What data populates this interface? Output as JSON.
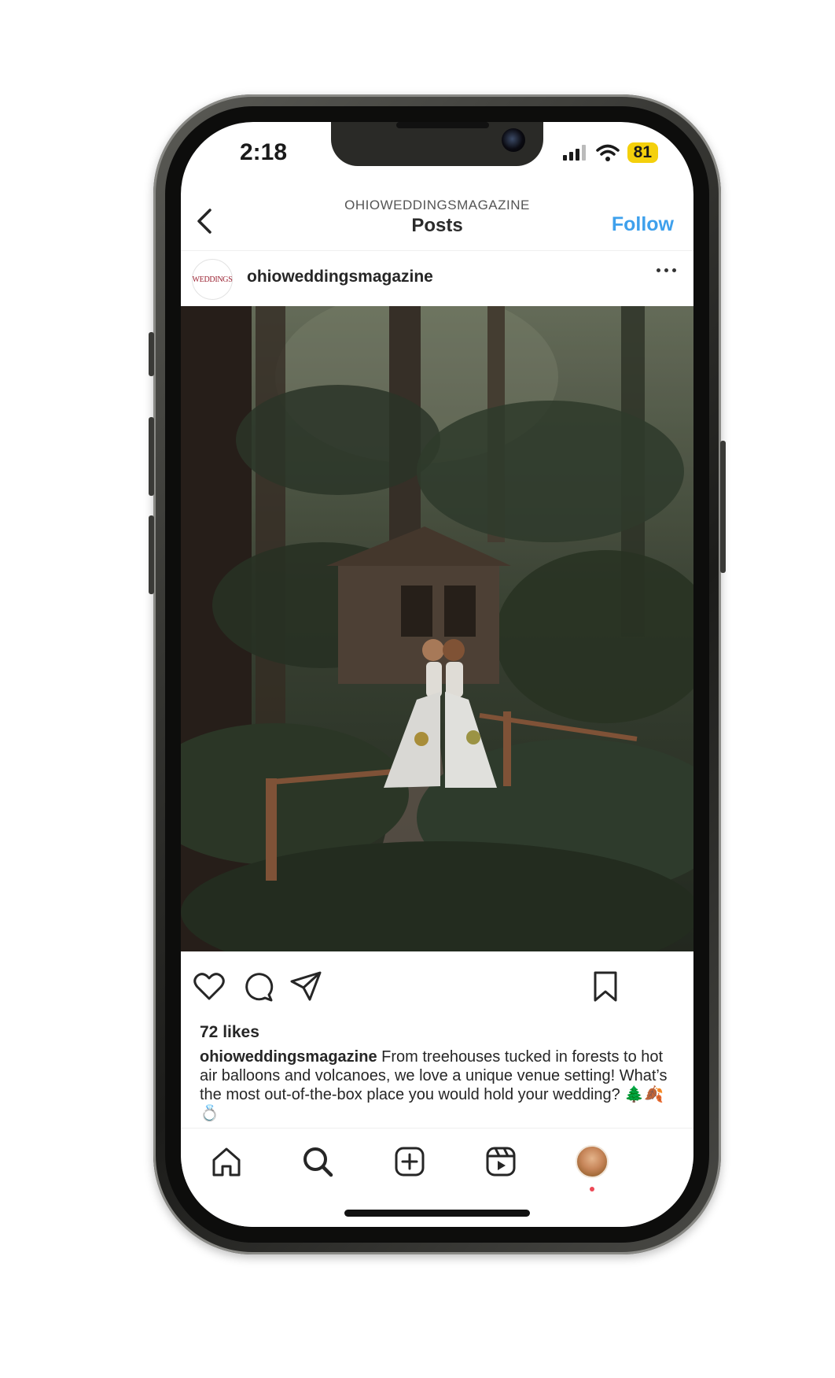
{
  "status_bar": {
    "time": "2:18",
    "battery_level": "81",
    "icons": [
      "signal-icon",
      "wifi-icon",
      "battery-icon"
    ]
  },
  "header": {
    "account": "OHIOWEDDINGSMAGAZINE",
    "title": "Posts",
    "follow_label": "Follow",
    "back_icon": "back-chevron-icon"
  },
  "post": {
    "username": "ohioweddingsmagazine",
    "avatar_text": "WEDDINGS",
    "more_icon": "more-options-icon",
    "image_icon": "photo",
    "likes": "72 likes",
    "caption_user": "ohioweddingsmagazine",
    "caption_text": " From treehouses tucked in forests to hot air balloons and volcanoes, we love a unique venue setting! What’s the most out-of-the-box place you would hold your wedding? 🌲🍂💍",
    "actions": [
      "heart-icon",
      "comment-icon",
      "share-icon",
      "bookmark-icon"
    ]
  },
  "tab_bar": {
    "tabs": [
      "home-icon",
      "search-icon",
      "create-icon",
      "reels-icon",
      "profile-avatar"
    ]
  },
  "colors": {
    "follow_blue": "#3ea0ec",
    "battery_yellow": "#f4d00c",
    "notification_red": "#ed4956"
  }
}
